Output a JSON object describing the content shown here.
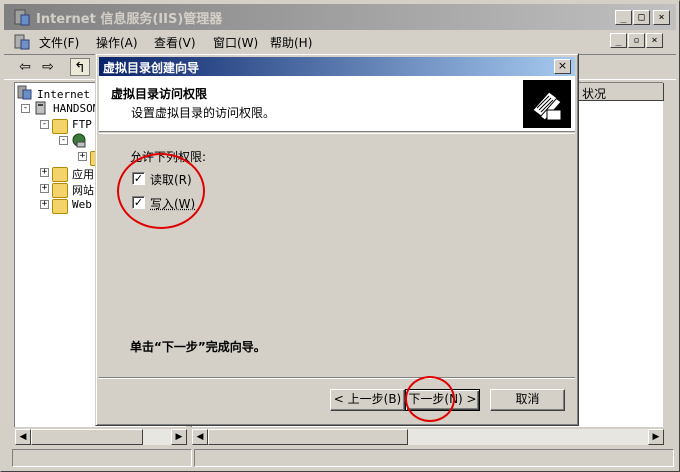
{
  "main_window": {
    "title": "Internet 信息服务(IIS)管理器",
    "caption_buttons": {
      "minimize": "_",
      "maximize": "□",
      "close": "×"
    },
    "menu": [
      {
        "label": "文件(F)"
      },
      {
        "label": "操作(A)"
      },
      {
        "label": "查看(V)"
      },
      {
        "label": "窗口(W)"
      },
      {
        "label": "帮助(H)"
      }
    ],
    "mdi_buttons": {
      "minimize": "_",
      "restore": "▫",
      "close": "×"
    },
    "toolbar": {
      "back": "⇦",
      "forward": "⇨",
      "up": "↰"
    },
    "tree": [
      {
        "expander": "-",
        "label": "Internet 信"
      },
      {
        "expander": "-",
        "label": "HANDSOM"
      },
      {
        "expander": "-",
        "label": "FTP"
      },
      {
        "expander": "-",
        "label": ""
      },
      {
        "expander": "+",
        "label": ""
      },
      {
        "expander": "+",
        "label": "应用"
      },
      {
        "expander": "+",
        "label": "网站"
      },
      {
        "expander": "+",
        "label": "Web"
      }
    ],
    "list_column": "状况",
    "scroll": {
      "left": "◀",
      "right": "▶"
    }
  },
  "wizard": {
    "title": "虚拟目录创建向导",
    "close": "×",
    "heading": "虚拟目录访问权限",
    "subheading": "设置虚拟目录的访问权限。",
    "permissions_label": "允许下列权限:",
    "permissions": [
      {
        "label": "读取(R)",
        "checked": true,
        "mark": "✓"
      },
      {
        "label": "写入(W)",
        "checked": true,
        "mark": "✓"
      }
    ],
    "finish_text": "单击“下一步”完成向导。",
    "buttons": {
      "back": "< 上一步(B)",
      "next": "下一步(N) >",
      "cancel": "取消"
    }
  },
  "colors": {
    "annotation": "#e00000",
    "active_title": "#0a246a",
    "inactive_title": "#808080",
    "face": "#d4d0c8"
  }
}
